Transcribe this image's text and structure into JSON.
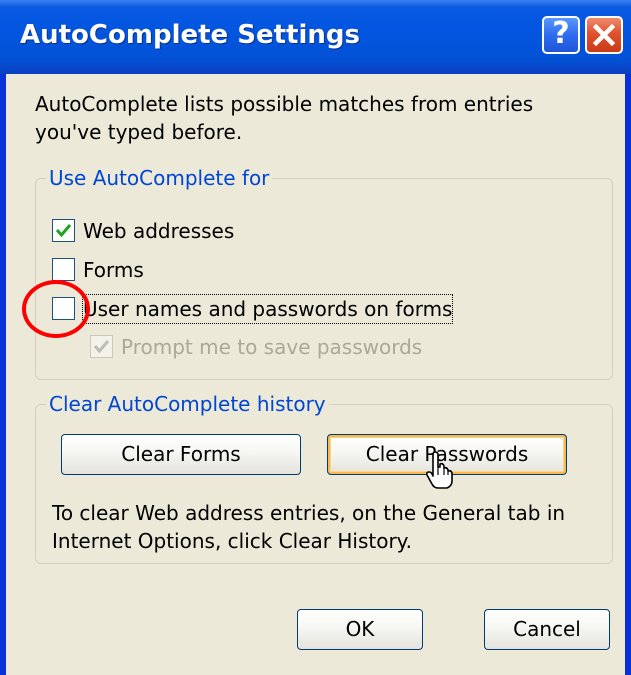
{
  "window": {
    "title": "AutoComplete Settings",
    "help_label": "?",
    "colors": {
      "titlebar": "#0155e0",
      "client": "#ece9d8",
      "group_label": "#0046d5",
      "focus_ring": "#f5b94f",
      "annotation": "#ff0000"
    }
  },
  "intro_text": "AutoComplete lists possible matches from entries you've typed before.",
  "use_group": {
    "legend": "Use AutoComplete for",
    "options": [
      {
        "label": "Web addresses",
        "checked": true,
        "enabled": true
      },
      {
        "label": "Forms",
        "checked": false,
        "enabled": true
      },
      {
        "label": "User names and passwords on forms",
        "checked": false,
        "enabled": true
      },
      {
        "label": "Prompt me to save passwords",
        "checked": true,
        "enabled": false
      }
    ]
  },
  "clear_group": {
    "legend": "Clear AutoComplete history",
    "clear_forms_label": "Clear Forms",
    "clear_passwords_label": "Clear Passwords",
    "help_text": "To clear Web address entries, on the General tab in Internet Options, click Clear History."
  },
  "footer": {
    "ok_label": "OK",
    "cancel_label": "Cancel"
  },
  "icons": [
    "help-icon",
    "close-icon",
    "check-icon",
    "hand-cursor-icon"
  ]
}
